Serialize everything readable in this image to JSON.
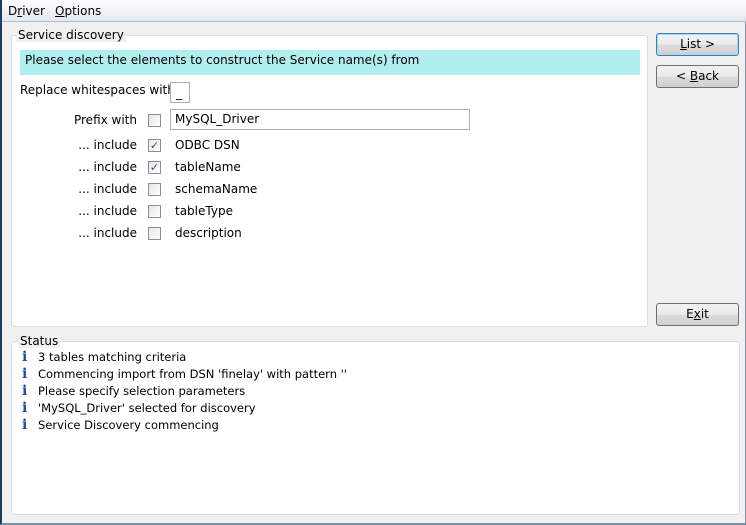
{
  "menu": [
    {
      "label_parts": [
        "D",
        "r",
        "iver"
      ]
    },
    {
      "label_parts": [
        "",
        "O",
        "ptions"
      ]
    }
  ],
  "discovery": {
    "legend": "Service discovery",
    "banner": "Please select the elements to construct the Service name(s) from",
    "replace_label": "Replace whitespaces with",
    "replace_value": "_",
    "prefix_label": "Prefix with",
    "prefix_checked": false,
    "prefix_value": "MySQL_Driver",
    "include_label": "... include",
    "items": [
      {
        "label": "ODBC DSN",
        "checked": true
      },
      {
        "label": "tableName",
        "checked": true
      },
      {
        "label": "schemaName",
        "checked": false
      },
      {
        "label": "tableType",
        "checked": false
      },
      {
        "label": "description",
        "checked": false
      }
    ]
  },
  "buttons": {
    "list": {
      "parts": [
        "",
        "L",
        "ist >"
      ]
    },
    "back": {
      "parts": [
        "< ",
        "B",
        "ack"
      ]
    },
    "exit": {
      "parts": [
        "E",
        "x",
        "it"
      ]
    }
  },
  "status": {
    "legend": "Status",
    "icon": "info-icon",
    "items": [
      "3 tables matching criteria",
      "Commencing import from DSN 'finelay' with pattern ''",
      "Please specify selection parameters",
      "'MySQL_Driver' selected for discovery",
      "Service Discovery commencing"
    ]
  }
}
